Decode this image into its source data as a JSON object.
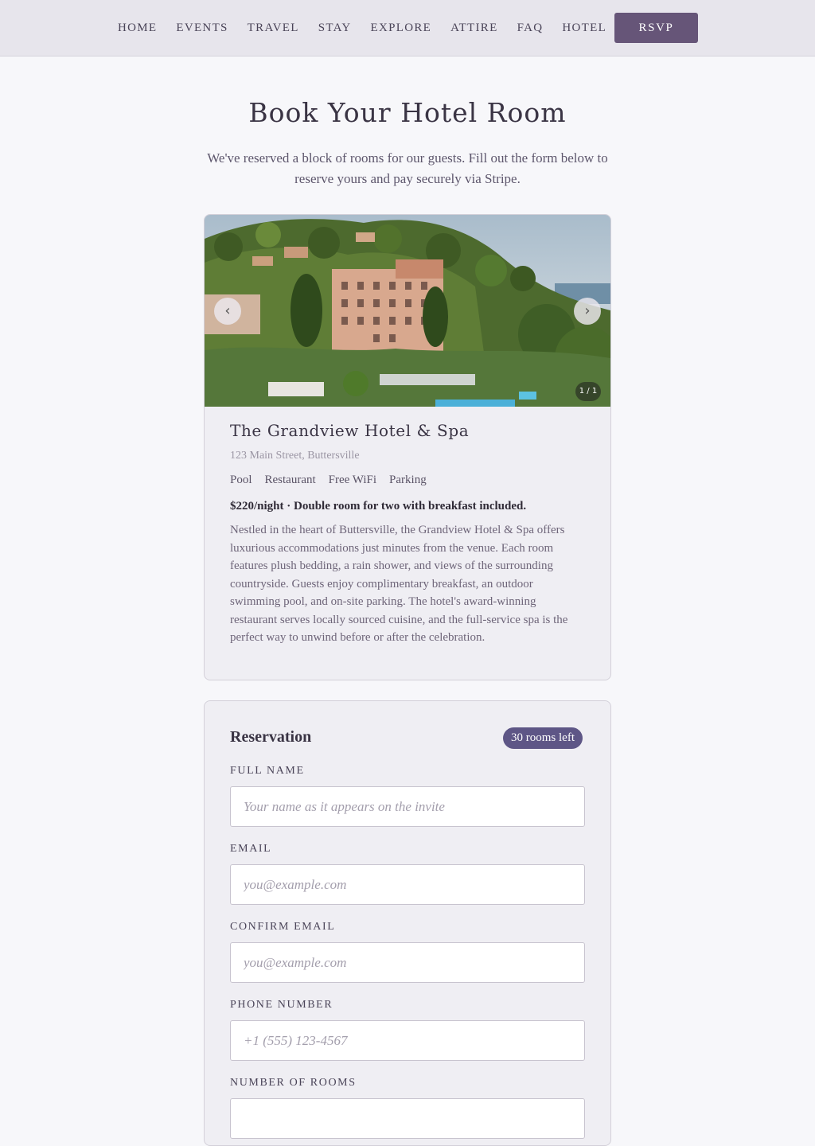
{
  "nav": {
    "links": [
      "HOME",
      "EVENTS",
      "TRAVEL",
      "STAY",
      "EXPLORE",
      "ATTIRE",
      "FAQ",
      "HOTEL"
    ],
    "rsvp_label": "RSVP"
  },
  "header": {
    "title": "Book Your Hotel Room",
    "intro": "We've reserved a block of rooms for our guests. Fill out the form below to reserve yours and pay securely via Stripe."
  },
  "hotel": {
    "carousel": {
      "prev_icon": "‹",
      "next_icon": "›",
      "counter": "1 / 1"
    },
    "name": "The Grandview Hotel & Spa",
    "address": "123 Main Street, Buttersville",
    "amenities": [
      "Pool",
      "Restaurant",
      "Free WiFi",
      "Parking"
    ],
    "price_line": "$220/night · Double room for two with breakfast included.",
    "description": "Nestled in the heart of Buttersville, the Grandview Hotel & Spa offers luxurious accommodations just minutes from the venue. Each room features plush bedding, a rain shower, and views of the surrounding countryside. Guests enjoy complimentary breakfast, an outdoor swimming pool, and on-site parking. The hotel's award-winning restaurant serves locally sourced cuisine, and the full-service spa is the perfect way to unwind before or after the celebration."
  },
  "reservation": {
    "title": "Reservation",
    "rooms_left": "30 rooms left",
    "fields": {
      "full_name": {
        "label": "FULL NAME",
        "placeholder": "Your name as it appears on the invite"
      },
      "email": {
        "label": "EMAIL",
        "placeholder": "you@example.com"
      },
      "confirm_email": {
        "label": "CONFIRM EMAIL",
        "placeholder": "you@example.com"
      },
      "phone": {
        "label": "PHONE NUMBER",
        "placeholder": "+1 (555) 123-4567"
      },
      "rooms": {
        "label": "NUMBER OF ROOMS"
      }
    }
  },
  "colors": {
    "accent": "#665578",
    "badge": "#5e5686",
    "page_bg": "#f7f7fa",
    "card_bg": "#efeef3"
  }
}
